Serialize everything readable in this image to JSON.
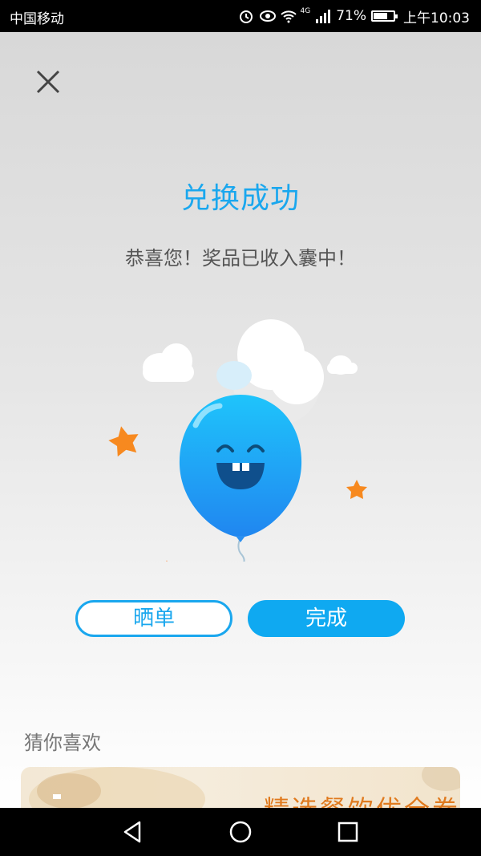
{
  "status_bar": {
    "carrier": "中国移动",
    "network": "4G",
    "battery": "71%",
    "battery_level": 0.71,
    "time": "上午10:03"
  },
  "dialog": {
    "close_icon": "close-icon",
    "title": "兑换成功",
    "subtitle": "恭喜您！奖品已收入囊中！",
    "share_label": "晒单",
    "done_label": "完成"
  },
  "recommend": {
    "section_title": "猜你喜欢",
    "banner_text": "精选餐饮优全券"
  },
  "nav": {
    "back_icon": "back-triangle-icon",
    "home_icon": "home-circle-icon",
    "recents_icon": "recents-square-icon"
  },
  "colors": {
    "accent": "#1aa7ee",
    "button_fill": "#0fa9f1",
    "balloon": "#29a8f5",
    "star": "#f7891f",
    "banner_text": "#e07a1e"
  }
}
